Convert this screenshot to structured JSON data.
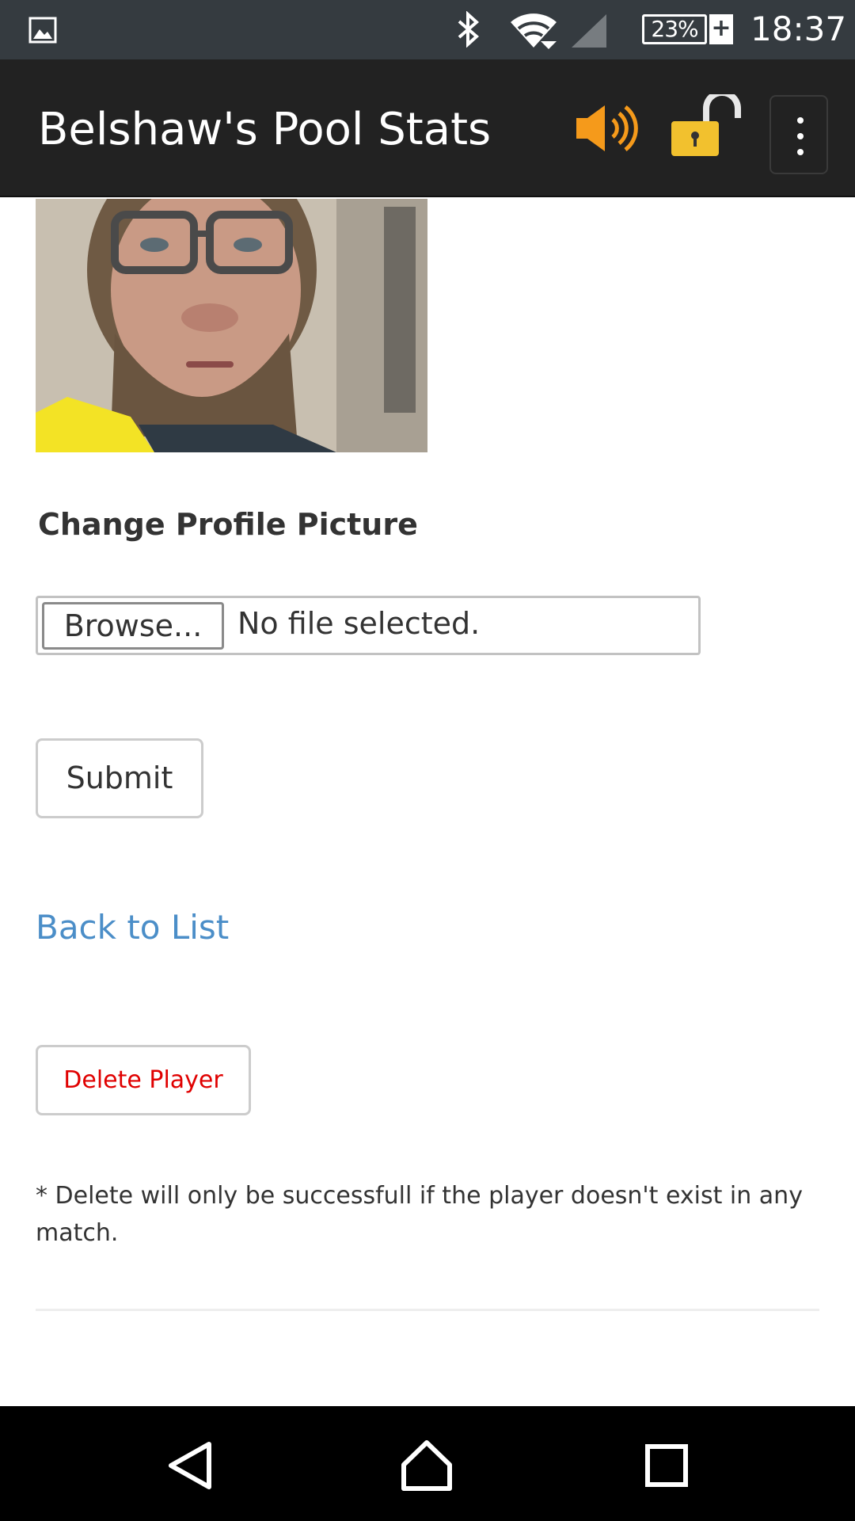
{
  "status_bar": {
    "icons": [
      "image-icon",
      "bluetooth-icon",
      "wifi-icon",
      "signal-icon",
      "battery-icon"
    ],
    "battery_percent": "23%",
    "charging_symbol": "+",
    "time": "18:37"
  },
  "app_bar": {
    "title": "Belshaw's Pool Stats",
    "icons": [
      "speaker-icon",
      "unlocked-padlock-icon",
      "overflow-menu-icon"
    ],
    "colors": {
      "background": "#222222",
      "speaker": "#f59a1b",
      "lock": "#f2c12e"
    }
  },
  "profile": {
    "photo_alt": "",
    "change_picture_heading": "Change Profile Picture",
    "browse_label": "Browse...",
    "file_status": "No file selected.",
    "submit_label": "Submit"
  },
  "links": {
    "back_to_list": "Back to List"
  },
  "delete": {
    "button_label": "Delete Player",
    "note": "* Delete will only be successfull if the player doesn't exist in any match."
  },
  "colors": {
    "link": "#4b8ec8",
    "danger": "#e00000",
    "text": "#333333"
  },
  "nav_bar": {
    "icons": [
      "back-icon",
      "home-icon",
      "recent-apps-icon"
    ]
  }
}
